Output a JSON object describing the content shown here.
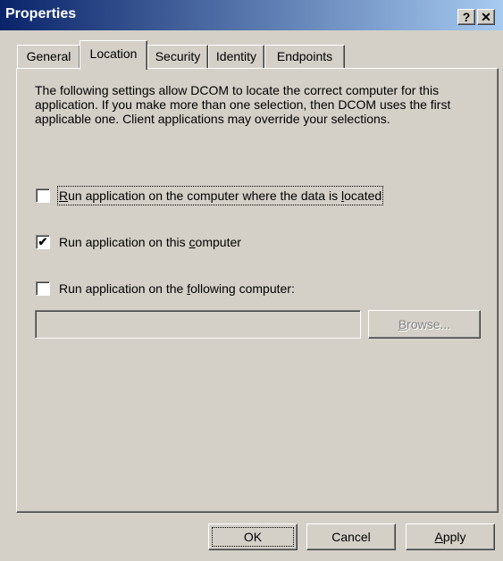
{
  "window": {
    "title": "Properties",
    "help_glyph": "?",
    "close_glyph": "✕"
  },
  "tabs": [
    {
      "label": "General"
    },
    {
      "label": "Location",
      "active": true
    },
    {
      "label": "Security"
    },
    {
      "label": "Identity"
    },
    {
      "label": "Endpoints"
    }
  ],
  "location": {
    "description": "The following settings allow DCOM to locate the correct computer for this application.  If you make more than one selection, then DCOM uses the first applicable one.  Client applications may override your selections.",
    "options": [
      {
        "pre": "",
        "accel": "R",
        "post": "un application on the computer where the data is ",
        "accel2": "l",
        "post2": "ocated",
        "checked": false
      },
      {
        "pre": "Run application on this ",
        "accel": "c",
        "post": "omputer",
        "checked": true
      },
      {
        "pre": "Run application on the ",
        "accel": "f",
        "post": "ollowing computer:",
        "checked": false
      }
    ],
    "computer_name_value": "",
    "browse": {
      "accel": "B",
      "rest": "rowse..."
    }
  },
  "buttons": {
    "ok": "OK",
    "cancel": "Cancel",
    "apply_accel": "A",
    "apply_rest": "pply"
  },
  "check_mark": "✔"
}
